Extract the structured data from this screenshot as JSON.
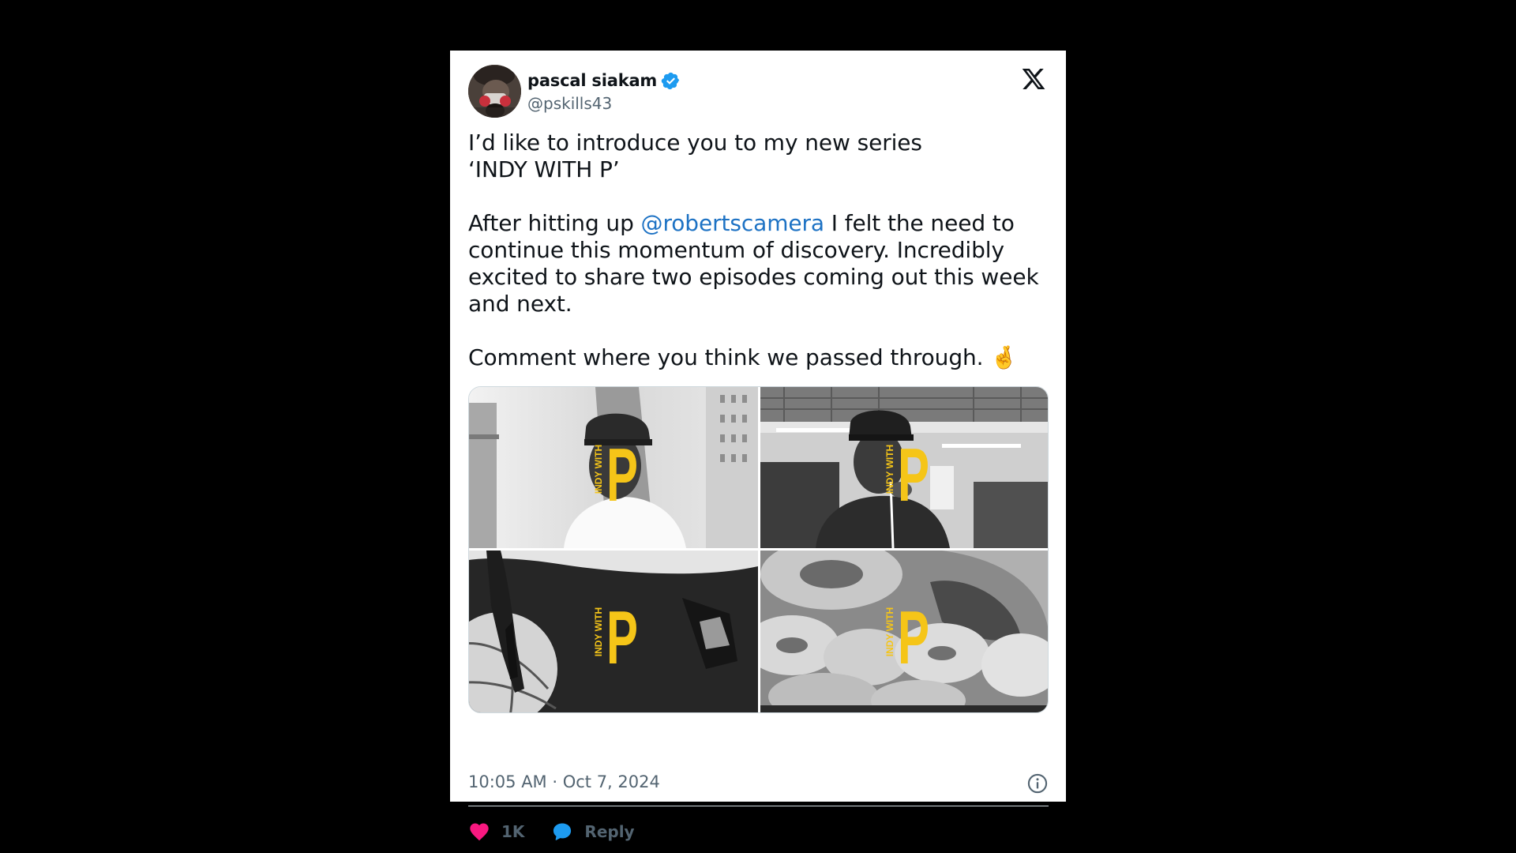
{
  "colors": {
    "page_background": "#000000",
    "card_background": "#ffffff",
    "verified_badge": "#1d9bf0",
    "mention": "#1d72c4",
    "like_heart": "#f91880",
    "reply_bubble": "#1d9bf0",
    "logo_yellow": "#f5c518"
  },
  "author": {
    "display_name": "pascal siakam",
    "handle": "@pskills43",
    "verified": true,
    "avatar_icon": "avatar-photo"
  },
  "platform_icon": "x-logo-icon",
  "tweet": {
    "line1": "I’d like to introduce you to my new series",
    "line2": "‘INDY WITH P’",
    "para2_before_mention": "After hitting up ",
    "mention": "@robertscamera",
    "para2_after_mention": " I felt the need to continue this momentum of discovery. Incredibly excited to share two episodes coming out this week and next.",
    "para3": "Comment where you think we passed through. ",
    "emoji": "🤞"
  },
  "media": {
    "logo_big_letter": "P",
    "logo_small_text": "INDY WITH",
    "tiles": [
      {
        "name": "media-photo-1"
      },
      {
        "name": "media-photo-2"
      },
      {
        "name": "media-photo-3"
      },
      {
        "name": "media-photo-4"
      }
    ]
  },
  "meta": {
    "timestamp": "10:05 AM · Oct 7, 2024",
    "info_icon": "info-icon"
  },
  "actions": {
    "likes_count": "1K",
    "reply_label": "Reply"
  }
}
